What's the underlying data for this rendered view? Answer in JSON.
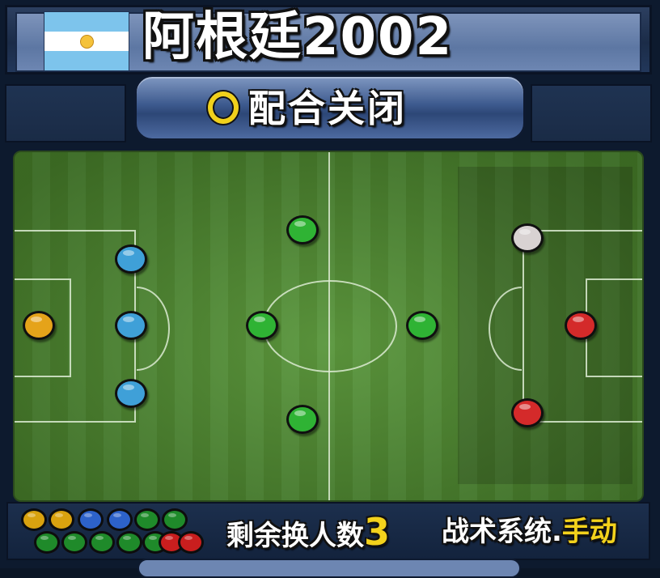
{
  "header": {
    "team_name": "阿根廷2002",
    "flag": {
      "icon": "argentina-flag-icon",
      "colors": [
        "#7dc4ec",
        "#ffffff",
        "#f5c23a"
      ]
    }
  },
  "toggle": {
    "icon": "circle-button-icon",
    "label": "配合关闭"
  },
  "pitch": {
    "players": [
      {
        "role": "goalkeeper",
        "color": "#e5a31a"
      },
      {
        "role": "defender",
        "color": "#3fa0d8"
      },
      {
        "role": "defender",
        "color": "#3fa0d8"
      },
      {
        "role": "defender",
        "color": "#3fa0d8"
      },
      {
        "role": "midfielder",
        "color": "#2fb334"
      },
      {
        "role": "midfielder",
        "color": "#2fb334"
      },
      {
        "role": "midfielder",
        "color": "#2fb334"
      },
      {
        "role": "midfielder",
        "color": "#2fb334"
      },
      {
        "role": "forward",
        "color": "#d8d2d2"
      },
      {
        "role": "forward",
        "color": "#d42a2a"
      },
      {
        "role": "forward",
        "color": "#d42a2a"
      }
    ]
  },
  "footer": {
    "roster_dots": [
      "#d9a20f",
      "#d9a20f",
      "#2d62c9",
      "#2d62c9",
      "#1f8a2a",
      "#1f8a2a",
      "#1f8a2a",
      "#1f8a2a",
      "#1f8a2a",
      "#1f8a2a",
      "#1f8a2a",
      "#c91e1e",
      "#c91e1e"
    ],
    "subs_label": "剩余换人数",
    "subs_value": "3",
    "tactics_label": "战术系统.",
    "tactics_value": "手动"
  }
}
